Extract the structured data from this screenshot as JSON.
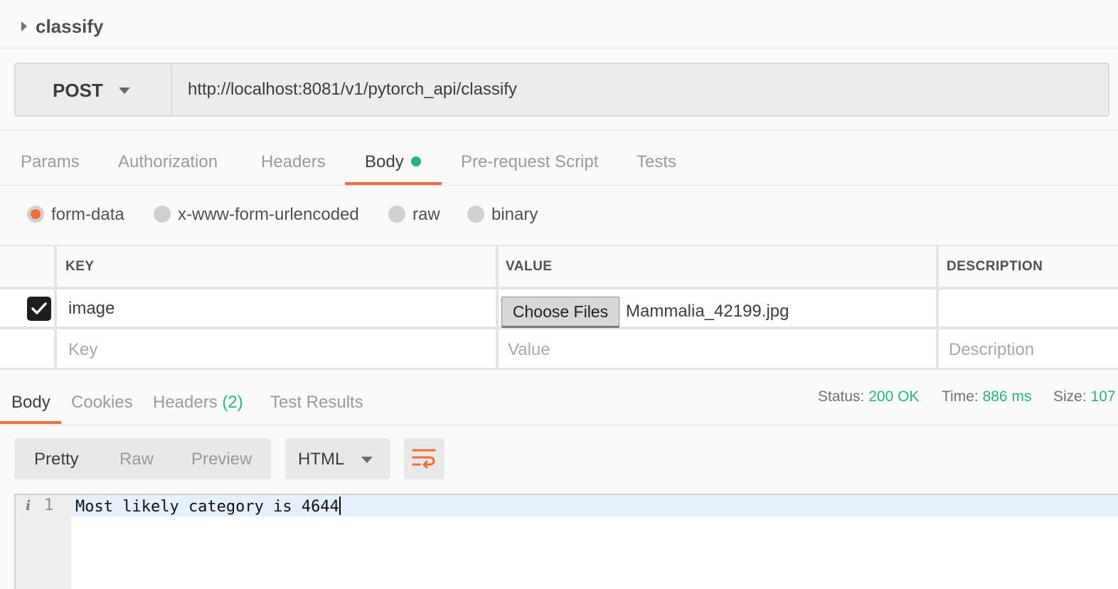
{
  "request": {
    "name": "classify",
    "method": "POST",
    "url": "http://localhost:8081/v1/pytorch_api/classify"
  },
  "request_tabs": [
    {
      "label": "Params"
    },
    {
      "label": "Authorization"
    },
    {
      "label": "Headers"
    },
    {
      "label": "Body",
      "active": true,
      "has_indicator": true
    },
    {
      "label": "Pre-request Script"
    },
    {
      "label": "Tests"
    }
  ],
  "body_types": [
    {
      "label": "form-data",
      "selected": true
    },
    {
      "label": "x-www-form-urlencoded"
    },
    {
      "label": "raw"
    },
    {
      "label": "binary"
    }
  ],
  "kv_table": {
    "headers": {
      "key": "KEY",
      "value": "VALUE",
      "description": "DESCRIPTION"
    },
    "rows": [
      {
        "checked": true,
        "key": "image",
        "file_button": "Choose Files",
        "file_name": "Mammalia_42199.jpg",
        "description": ""
      }
    ],
    "placeholders": {
      "key": "Key",
      "value": "Value",
      "description": "Description"
    }
  },
  "response_tabs": [
    {
      "label": "Body",
      "active": true
    },
    {
      "label": "Cookies"
    },
    {
      "label": "Headers",
      "count": "(2)"
    },
    {
      "label": "Test Results"
    }
  ],
  "status": {
    "status_label": "Status:",
    "status_value": "200 OK",
    "time_label": "Time:",
    "time_value": "886 ms",
    "size_label": "Size:",
    "size_value": "107"
  },
  "view_modes": [
    "Pretty",
    "Raw",
    "Preview"
  ],
  "active_view_mode": "Pretty",
  "format": "HTML",
  "editor": {
    "line_number": "1",
    "info_glyph": "i",
    "content": "Most likely category is 4644"
  },
  "colors": {
    "accent": "#f26b3a",
    "success": "#26b47f"
  }
}
